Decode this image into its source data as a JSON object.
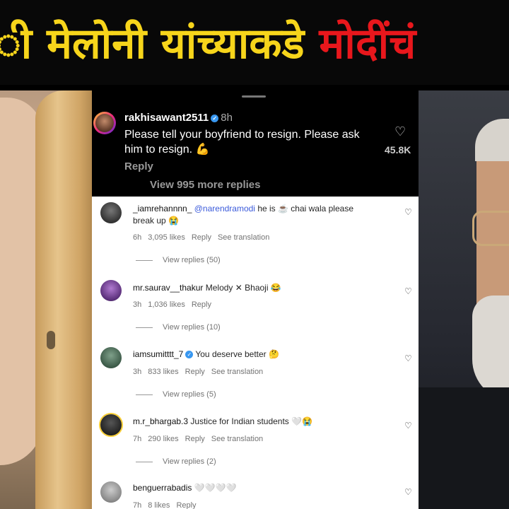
{
  "headline": {
    "part1": "ी मेलोनी यांच्याकडे ",
    "part2": "मोदींचं",
    "color_main": "#f7d51b",
    "color_accent": "#e8171c"
  },
  "top_comment": {
    "username": "rakhisawant2511",
    "time": "8h",
    "text": "Please tell your boyfriend to resign. Please ask him to resign. 💪",
    "reply_label": "Reply",
    "view_replies": "View 995 more replies",
    "likes": "45.8K",
    "heart_icon": "heart-outline-icon"
  },
  "comments": [
    {
      "username": "_iamrehannnn_",
      "mention": "@narendramodi",
      "text": " he is ☕ chai wala please break up 😭",
      "time": "6h",
      "likes": "3,095 likes",
      "reply": "Reply",
      "translation": "See translation",
      "view_replies": "View replies (50)"
    },
    {
      "username": "mr.saurav__thakur",
      "mention": "",
      "text": "Melody ✕ Bhaoji 😂",
      "time": "3h",
      "likes": "1,036 likes",
      "reply": "Reply",
      "translation": "",
      "view_replies": "View replies (10)"
    },
    {
      "username": "iamsumitttt_7",
      "mention": "",
      "text": "You deserve better 🤔",
      "time": "3h",
      "likes": "833 likes",
      "reply": "Reply",
      "translation": "See translation",
      "view_replies": "View replies (5)"
    },
    {
      "username": "m.r_bhargab.3",
      "mention": "",
      "text": "Justice for Indian students 🤍😭",
      "time": "7h",
      "likes": "290 likes",
      "reply": "Reply",
      "translation": "See translation",
      "view_replies": "View replies (2)"
    },
    {
      "username": "benguerrabadis",
      "mention": "",
      "text": "🤍🤍🤍🤍",
      "time": "7h",
      "likes": "8 likes",
      "reply": "Reply",
      "translation": "",
      "view_replies": ""
    }
  ]
}
